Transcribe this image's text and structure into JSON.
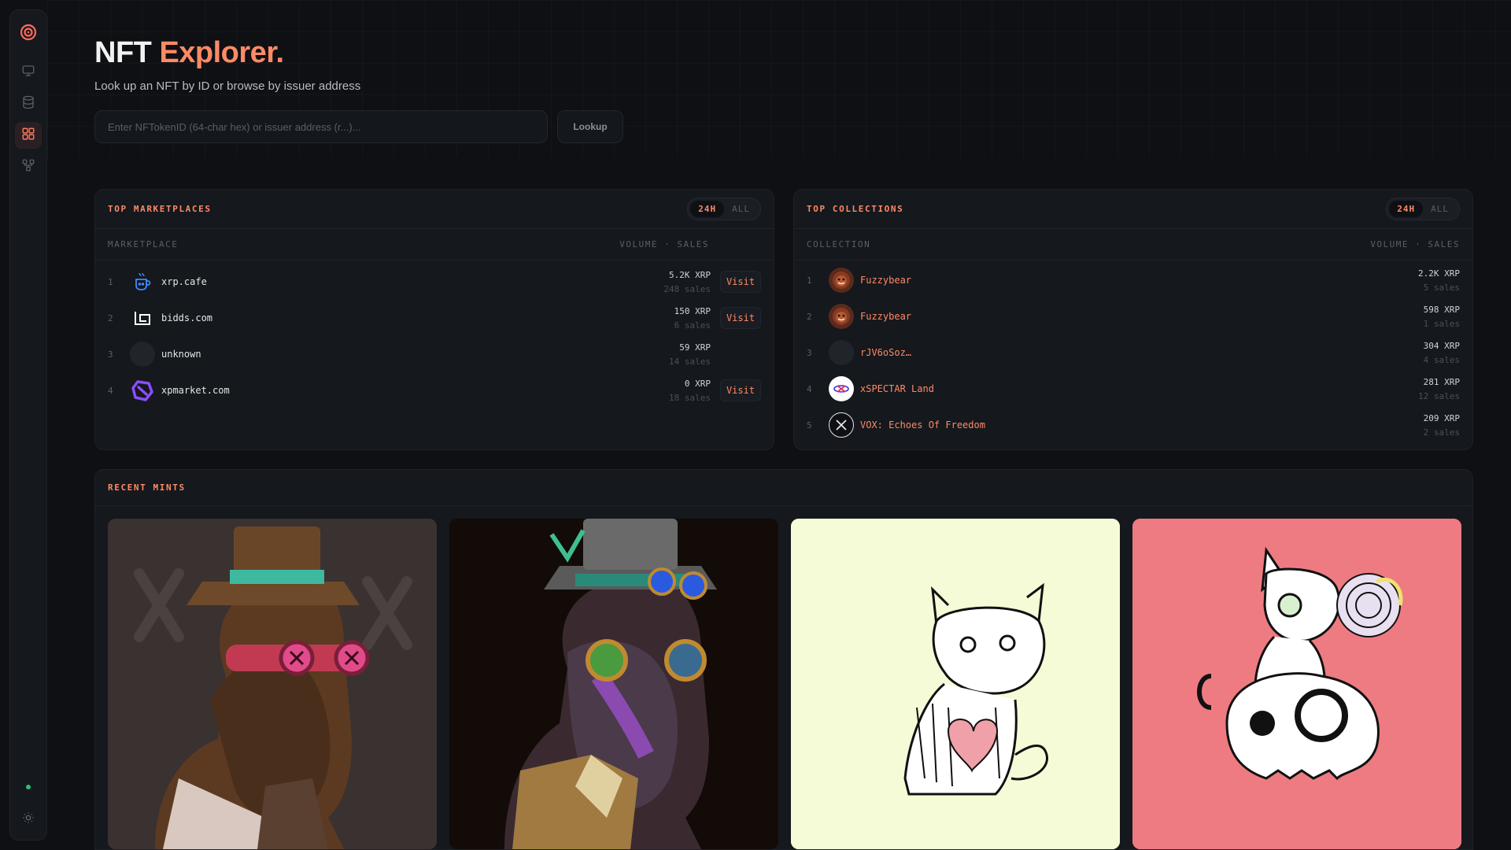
{
  "page": {
    "title": "NFT",
    "title_accent": "Explorer.",
    "subtitle": "Look up an NFT by ID or browse by issuer address"
  },
  "sidebar": {
    "items": [
      {
        "icon": "monitor-icon",
        "active": false
      },
      {
        "icon": "database-icon",
        "active": false
      },
      {
        "icon": "grid-icon",
        "active": true
      },
      {
        "icon": "network-icon",
        "active": false
      }
    ],
    "status": "online",
    "theme_icon": "sun-icon"
  },
  "search": {
    "placeholder": "Enter NFTokenID (64-char hex) or issuer address (r...)...",
    "value": "",
    "button_label": "Lookup"
  },
  "colors": {
    "accent": "#ff8a65",
    "background": "#0e1014",
    "panel": "#15181d",
    "status_online": "#2fbf71"
  },
  "marketplaces": {
    "title": "TOP MARKETPLACES",
    "toggle": [
      "24H",
      "ALL"
    ],
    "toggle_selected": "24H",
    "col_name": "MARKETPLACE",
    "col_stats": "VOLUME · SALES",
    "rows": [
      {
        "rank": "1",
        "name": "xrp.cafe",
        "logo": "coffee-cup-icon",
        "volume": "5.2K XRP",
        "sales": "248 sales",
        "visit": "Visit"
      },
      {
        "rank": "2",
        "name": "bidds.com",
        "logo": "bidds-logo-icon",
        "volume": "150 XRP",
        "sales": "6 sales",
        "visit": "Visit"
      },
      {
        "rank": "3",
        "name": "unknown",
        "logo": "blank-avatar-icon",
        "volume": "59 XRP",
        "sales": "14 sales",
        "visit": ""
      },
      {
        "rank": "4",
        "name": "xpmarket.com",
        "logo": "xpmarket-logo-icon",
        "volume": "0 XRP",
        "sales": "18 sales",
        "visit": "Visit"
      }
    ]
  },
  "collections": {
    "title": "TOP COLLECTIONS",
    "toggle": [
      "24H",
      "ALL"
    ],
    "toggle_selected": "24H",
    "col_name": "COLLECTION",
    "col_stats": "VOLUME · SALES",
    "rows": [
      {
        "rank": "1",
        "name": "Fuzzybear",
        "logo": "fuzzybear-avatar",
        "volume": "2.2K XRP",
        "sales": "5 sales"
      },
      {
        "rank": "2",
        "name": "Fuzzybear",
        "logo": "fuzzybear-avatar",
        "volume": "598 XRP",
        "sales": "1 sales"
      },
      {
        "rank": "3",
        "name": "rJV6oSoz…",
        "logo": "blank-avatar-icon",
        "volume": "304 XRP",
        "sales": "4 sales"
      },
      {
        "rank": "4",
        "name": "xSPECTAR Land",
        "logo": "xspectar-logo",
        "volume": "281 XRP",
        "sales": "12 sales"
      },
      {
        "rank": "5",
        "name": "VOX: Echoes Of Freedom",
        "logo": "x-circle-logo",
        "volume": "209 XRP",
        "sales": "2 sales"
      }
    ]
  },
  "recent_mints": {
    "title": "RECENT MINTS",
    "cards": [
      {
        "image": "steampunk-horse-pink-goggles",
        "bg": "#3a3230"
      },
      {
        "image": "steampunk-horse-blue-goggles",
        "bg": "#120b08"
      },
      {
        "image": "sketch-cat-heart",
        "bg": "#f5fbd6"
      },
      {
        "image": "sketch-cat-skull",
        "bg": "#ee7b82"
      }
    ]
  }
}
